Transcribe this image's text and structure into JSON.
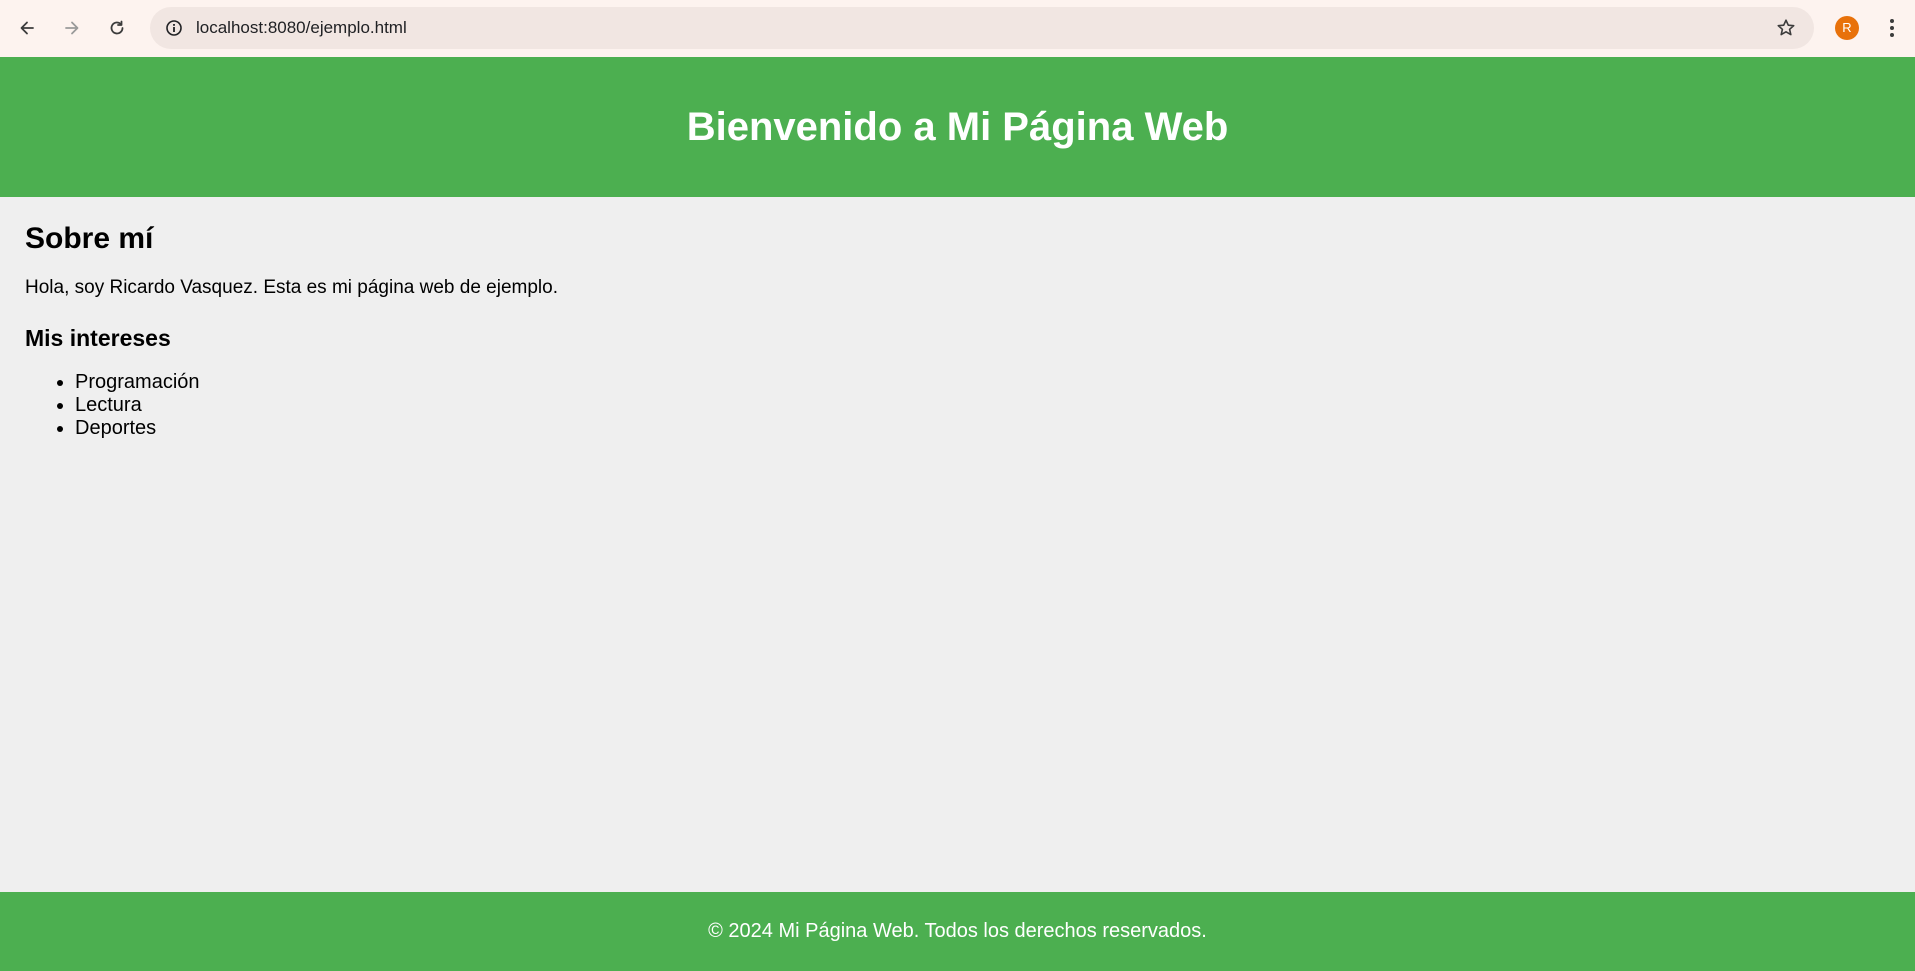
{
  "browser": {
    "url": "localhost:8080/ejemplo.html",
    "profile_initial": "R",
    "icons": {
      "back": "back-arrow-icon",
      "forward": "forward-arrow-icon",
      "reload": "reload-icon",
      "site_info": "info-icon",
      "bookmark": "star-icon",
      "menu": "kebab-menu-icon"
    }
  },
  "header": {
    "title": "Bienvenido a Mi Página Web"
  },
  "main": {
    "about_heading": "Sobre mí",
    "about_text": "Hola, soy Ricardo Vasquez. Esta es mi página web de ejemplo.",
    "interests_heading": "Mis intereses",
    "interests": [
      "Programación",
      "Lectura",
      "Deportes"
    ]
  },
  "footer": {
    "text": "© 2024 Mi Página Web. Todos los derechos reservados."
  },
  "colors": {
    "header_bg": "#4caf50",
    "footer_bg": "#4caf50",
    "page_bg": "#efefef",
    "chrome_bg": "#fdf3ef",
    "avatar_bg": "#e8710a"
  }
}
